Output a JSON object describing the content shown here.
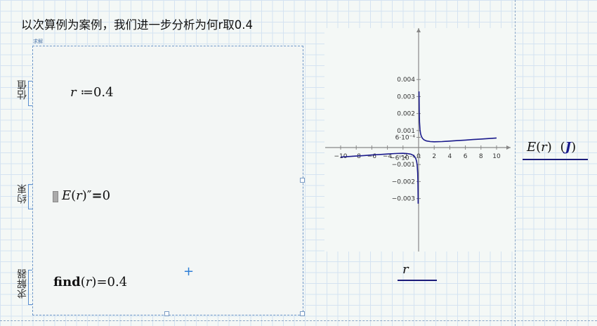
{
  "title": "以次算例为案例，我们进一步分析为何r取0.4",
  "solve_block": {
    "label": "求解",
    "guess_label": "估值",
    "constraint_label": "约束",
    "solver_label": "求解器",
    "guess": {
      "var": "r",
      "op": "≔",
      "value": "0.4"
    },
    "constraint": {
      "func": "E",
      "arg": "r",
      "prime": "″",
      "eq": "=",
      "rhs": "0"
    },
    "solver": {
      "func": "find",
      "arg": "r",
      "eq": "=",
      "value": "0.4"
    }
  },
  "plot": {
    "x_axis_label": "r",
    "y_axis_label_func": "E",
    "y_axis_label_arg": "r",
    "y_axis_unit": "J",
    "line_color": "#1a1a8c"
  },
  "chart_data": {
    "type": "line",
    "xlim": [
      -11,
      11
    ],
    "ylim": [
      -0.0035,
      0.0042
    ],
    "x_ticks": [
      -10,
      -8,
      -6,
      -4,
      -2,
      0,
      2,
      4,
      6,
      8,
      10
    ],
    "x_tick_labels": [
      "−10",
      "−8",
      "−6",
      "−4",
      "−2",
      "0",
      "2",
      "4",
      "6",
      "8",
      "10"
    ],
    "y_ticks": [
      0.004,
      0.003,
      0.002,
      0.001,
      0.0006,
      -0.0006,
      -0.001,
      -0.002,
      -0.003
    ],
    "y_tick_labels": [
      "0.004",
      "0.003",
      "0.002",
      "0.001",
      "6·10⁻⁴",
      "−6·10⁻⁴",
      "−0.001",
      "−0.002",
      "−0.003"
    ],
    "series": [
      {
        "x": [
          0.05,
          0.08,
          0.12,
          0.18,
          0.25,
          0.35,
          0.5,
          0.7,
          1.0,
          1.5,
          2,
          3,
          4,
          5,
          6,
          7,
          8,
          9,
          10
        ],
        "y": [
          0.0033,
          0.0022,
          0.0015,
          0.00105,
          0.00082,
          0.00066,
          0.00054,
          0.00045,
          0.00039,
          0.00035,
          0.00034,
          0.00035,
          0.00038,
          0.00041,
          0.00044,
          0.00047,
          0.0005,
          0.00053,
          0.00056
        ]
      },
      {
        "x": [
          -10,
          -9,
          -8,
          -7,
          -6,
          -5,
          -4,
          -3,
          -2,
          -1.5,
          -1.0,
          -0.7,
          -0.5,
          -0.35,
          -0.25,
          -0.18,
          -0.12,
          -0.08,
          -0.05
        ],
        "y": [
          -0.00056,
          -0.00053,
          -0.0005,
          -0.00047,
          -0.00044,
          -0.00041,
          -0.00038,
          -0.00035,
          -0.00034,
          -0.00035,
          -0.00039,
          -0.00045,
          -0.00054,
          -0.00066,
          -0.00082,
          -0.00105,
          -0.0015,
          -0.0022,
          -0.0033
        ]
      }
    ]
  }
}
